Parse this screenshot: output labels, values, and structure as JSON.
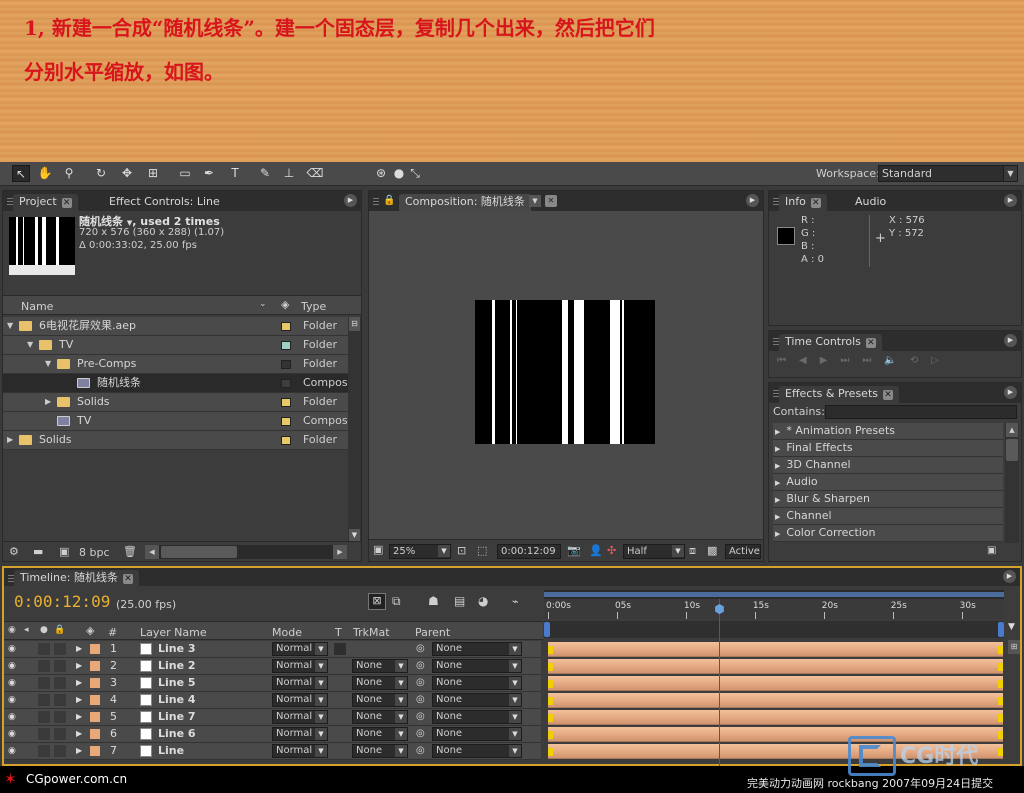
{
  "header": {
    "line1": "1, 新建一合成“随机线条”。建一个固态层，复制几个出来，然后把它们",
    "line2": "分别水平缩放，如图。"
  },
  "toolbar": {
    "workspace_label": "Workspace:",
    "workspace_value": "Standard"
  },
  "project": {
    "tab_project": "Project",
    "tab_effect_controls": "Effect Controls: Line",
    "item_name": "随机线条",
    "item_used": ", used 2 times",
    "item_dims": "720 x 576  (360 x 288) (1.07)",
    "item_duration": "Δ 0:00:33:02, 25.00 fps",
    "col_name": "Name",
    "col_type": "Type",
    "rows": [
      {
        "name": "6电视花屏效果.aep",
        "type": "Folder",
        "label_color": "#e8c96a"
      },
      {
        "name": "TV",
        "type": "Folder",
        "label_color": "#9fcfc4"
      },
      {
        "name": "Pre-Comps",
        "type": "Folder",
        "label_color": "#333333"
      },
      {
        "name": "随机线条",
        "type": "Composit",
        "label_color": "#3e3e3e"
      },
      {
        "name": "Solids",
        "type": "Folder",
        "label_color": "#e8c96a"
      },
      {
        "name": "TV",
        "type": "Composit",
        "label_color": "#e8c96a"
      },
      {
        "name": "Solids",
        "type": "Folder",
        "label_color": "#e8c96a"
      }
    ],
    "bpc": "8 bpc"
  },
  "composition": {
    "tab": "Composition: 随机线条",
    "zoom": "25%",
    "timecode": "0:00:12:09",
    "resolution": "Half",
    "view": "Active"
  },
  "info": {
    "tab_info": "Info",
    "tab_audio": "Audio",
    "r": "R :",
    "g": "G :",
    "b": "B :",
    "a": "A : 0",
    "x": "X : 576",
    "y": "Y : 572"
  },
  "time_controls": {
    "tab": "Time Controls"
  },
  "effects": {
    "tab": "Effects & Presets",
    "contains": "Contains:",
    "items": [
      "* Animation Presets",
      "Final Effects",
      "3D Channel",
      "Audio",
      "Blur & Sharpen",
      "Channel",
      "Color Correction"
    ]
  },
  "timeline": {
    "tab": "Timeline: 随机线条",
    "timecode": "0:00:12:09",
    "fps": "(25.00 fps)",
    "col_hash": "#",
    "col_layer": "Layer Name",
    "col_mode": "Mode",
    "col_t": "T",
    "col_trkmat": "TrkMat",
    "col_parent": "Parent",
    "ruler": [
      "0:00s",
      "05s",
      "10s",
      "15s",
      "20s",
      "25s",
      "30s"
    ],
    "layers": [
      {
        "num": "1",
        "name": "Line 3",
        "mode": "Normal",
        "trkmat": "",
        "parent": "None"
      },
      {
        "num": "2",
        "name": "Line 2",
        "mode": "Normal",
        "trkmat": "None",
        "parent": "None"
      },
      {
        "num": "3",
        "name": "Line 5",
        "mode": "Normal",
        "trkmat": "None",
        "parent": "None"
      },
      {
        "num": "4",
        "name": "Line 4",
        "mode": "Normal",
        "trkmat": "None",
        "parent": "None"
      },
      {
        "num": "5",
        "name": "Line 7",
        "mode": "Normal",
        "trkmat": "None",
        "parent": "None"
      },
      {
        "num": "6",
        "name": "Line 6",
        "mode": "Normal",
        "trkmat": "None",
        "parent": "None"
      },
      {
        "num": "7",
        "name": "Line",
        "mode": "Normal",
        "trkmat": "None",
        "parent": "None"
      }
    ],
    "playhead_fraction": 0.383
  },
  "footer": {
    "site": "CGpower.com.cn",
    "credit": "完美动力动画网 rockbang 2007年09月24日提交",
    "logo_text": "CG时代"
  },
  "colors": {
    "accent": "#d8a02c",
    "title_red": "#d8141c",
    "layer_bar": "#e8b08a"
  }
}
